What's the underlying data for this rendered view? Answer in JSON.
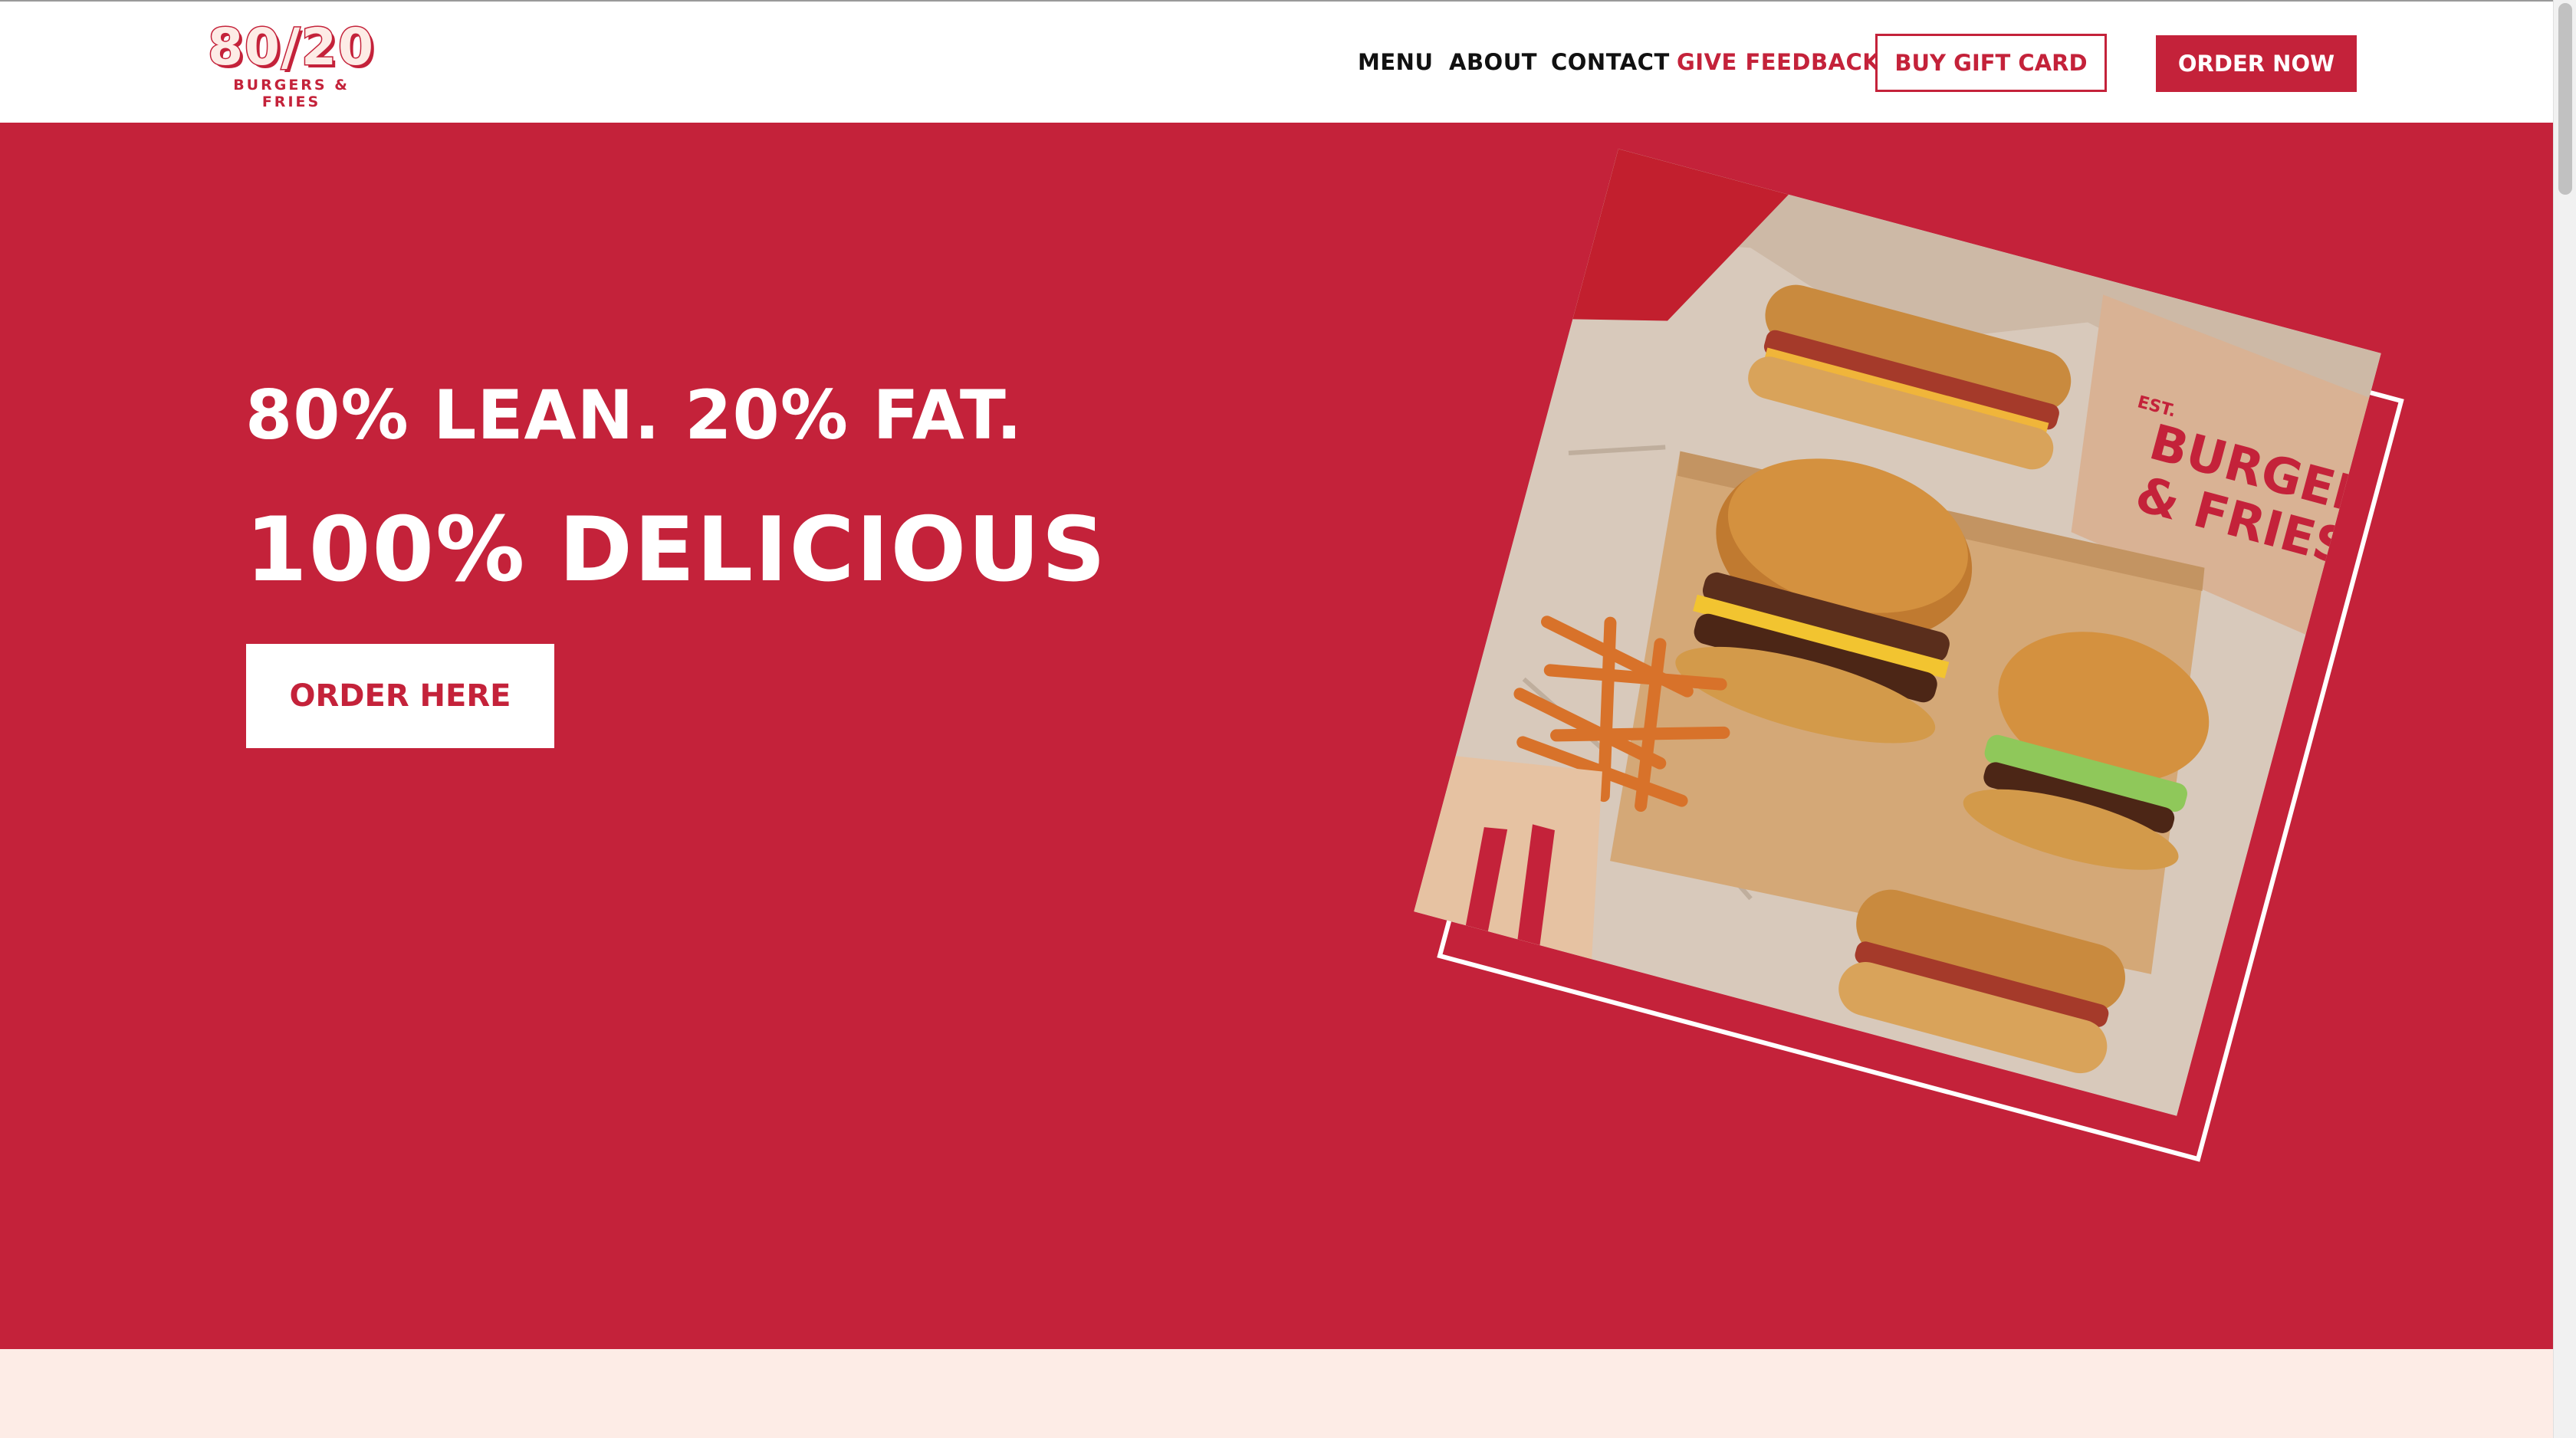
{
  "brand": {
    "logo_main": "80/20",
    "logo_sub": "BURGERS & FRIES"
  },
  "nav": {
    "items": [
      "MENU",
      "ABOUT",
      "CONTACT",
      "GIVE FEEDBACK"
    ],
    "buy_gift_card": "BUY GIFT CARD",
    "order_now": "ORDER NOW"
  },
  "hero": {
    "line1": "80% LEAN. 20% FAT.",
    "line2": "100% DELICIOUS",
    "cta": "ORDER HERE",
    "bag_text_1": "BURGERS",
    "bag_text_2": "& FRIES",
    "bag_text_est": "EST."
  },
  "colors": {
    "brand_red": "#c4223a",
    "cream": "#fdece6",
    "white": "#ffffff"
  },
  "icons": {
    "food_photo": "burgers-and-fries-photo"
  }
}
